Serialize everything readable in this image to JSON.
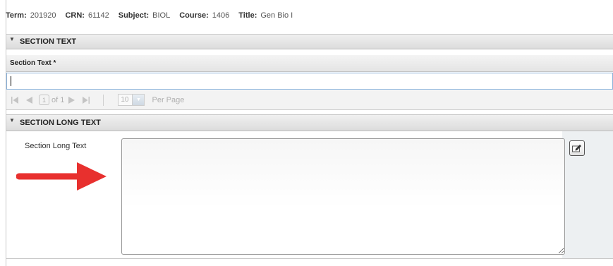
{
  "header": {
    "term_label": "Term:",
    "term_value": "201920",
    "crn_label": "CRN:",
    "crn_value": "61142",
    "subject_label": "Subject:",
    "subject_value": "BIOL",
    "course_label": "Course:",
    "course_value": "1406",
    "title_label": "Title:",
    "title_value": "Gen Bio I"
  },
  "section_text": {
    "heading": "SECTION TEXT",
    "column_header": "Section Text *",
    "value": ""
  },
  "pager": {
    "page": "1",
    "of_text": "of 1",
    "per_page_value": "10",
    "per_page_label": "Per Page"
  },
  "section_long_text": {
    "heading": "SECTION LONG TEXT",
    "field_label": "Section Long Text",
    "value": ""
  },
  "colors": {
    "arrow": "#e8302e",
    "input_border": "#8ab1d8",
    "header_bg": "#dcdcdc"
  },
  "icons": {
    "collapse": "triangle-down-icon",
    "first_page": "first-page-icon",
    "prev_page": "prev-page-icon",
    "next_page": "next-page-icon",
    "last_page": "last-page-icon",
    "edit": "edit-pencil-icon"
  }
}
